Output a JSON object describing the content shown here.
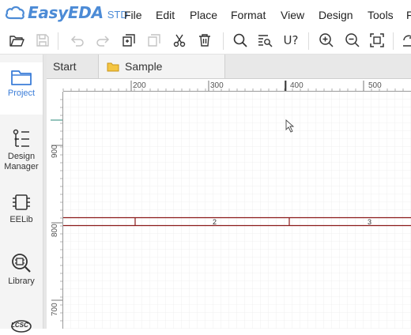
{
  "app": {
    "logo_name": "EasyEDA",
    "edition": "STD"
  },
  "menu": [
    "File",
    "Edit",
    "Place",
    "Format",
    "View",
    "Design",
    "Tools",
    "F"
  ],
  "toolbar": {
    "tools": [
      "open-folder-icon",
      "save-icon",
      "undo-icon",
      "redo-icon",
      "copy-icon",
      "paste-icon",
      "cut-icon",
      "delete-icon",
      "search-icon",
      "find-icon",
      "find-similar-icon",
      "zoom-in-icon",
      "zoom-out-icon",
      "fit-icon",
      "rotate-icon"
    ],
    "find_similar_label": "U?"
  },
  "left_nav": {
    "items": [
      {
        "label": "Project",
        "icon": "folder-icon",
        "active": true
      },
      {
        "label": "Design Manager",
        "icon": "design-manager-icon",
        "active": false
      },
      {
        "label": "EELib",
        "icon": "chip-icon",
        "active": false
      },
      {
        "label": "Library",
        "icon": "library-search-icon",
        "active": false
      },
      {
        "label": "LCSC",
        "icon": "lcsc-icon",
        "active": false
      }
    ]
  },
  "tabs": [
    {
      "label": "Start",
      "active": false
    },
    {
      "label": "Sample",
      "active": true
    }
  ],
  "canvas": {
    "ruler_x_labels": [
      "200",
      "300",
      "400",
      "500"
    ],
    "ruler_y_labels": [
      "900",
      "800",
      "700"
    ],
    "frame_zone_labels": [
      "2",
      "3"
    ]
  },
  "colors": {
    "brand": "#4c8bd6",
    "frame_line": "#8b1a1a",
    "grid": "#e9e9e9"
  }
}
